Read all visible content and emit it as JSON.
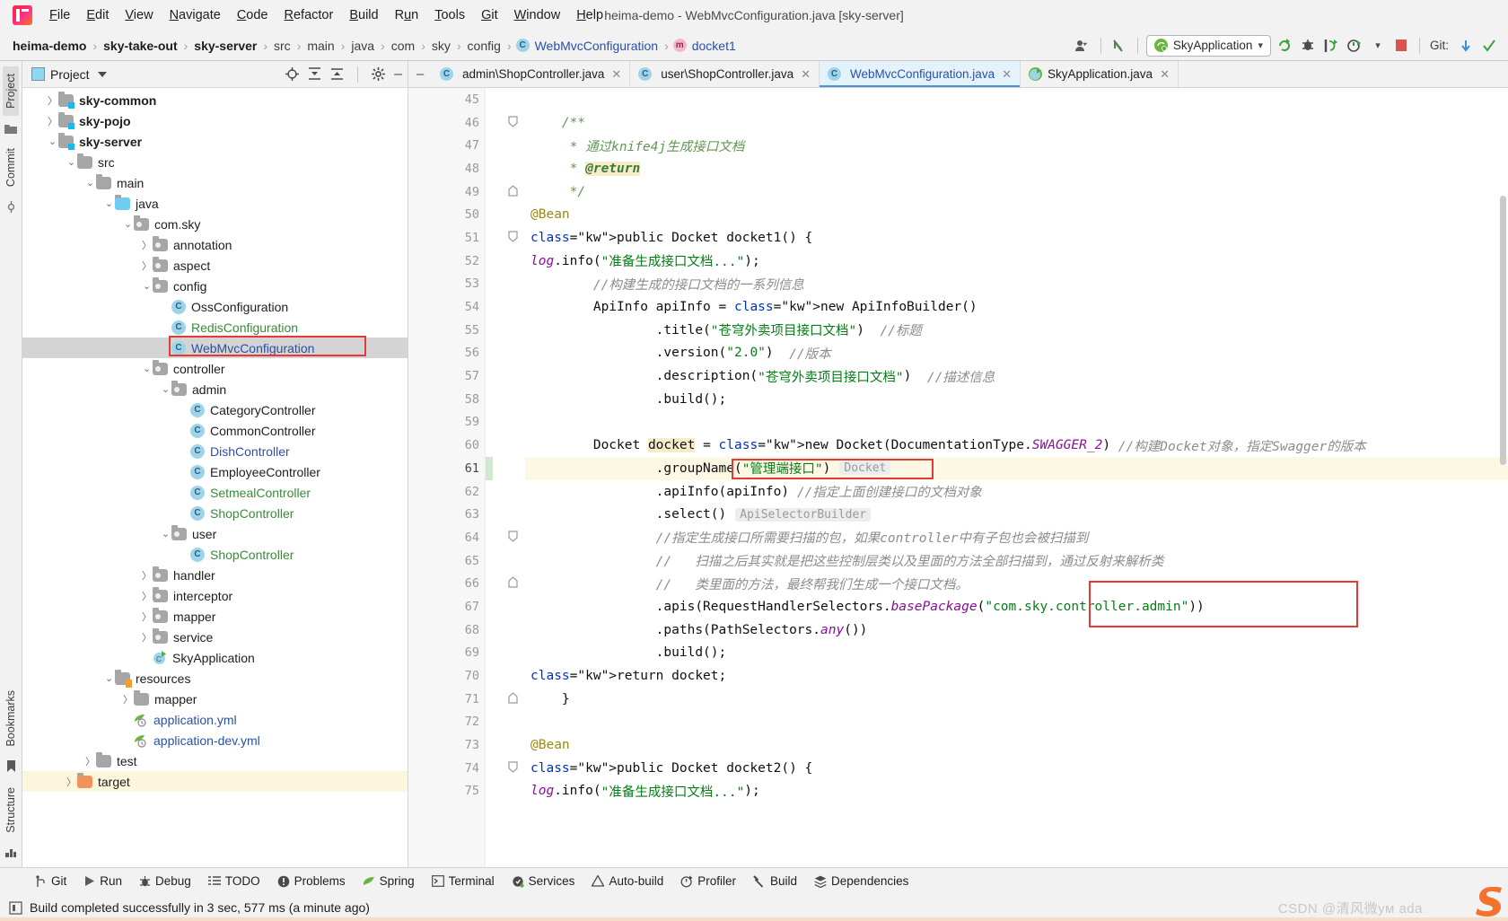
{
  "window": {
    "title": "heima-demo - WebMvcConfiguration.java [sky-server]"
  },
  "menubar": {
    "logo_icon": "intellij-idea-logo",
    "items": [
      {
        "label": "File"
      },
      {
        "label": "Edit"
      },
      {
        "label": "View"
      },
      {
        "label": "Navigate"
      },
      {
        "label": "Code"
      },
      {
        "label": "Refactor"
      },
      {
        "label": "Build"
      },
      {
        "label": "Run"
      },
      {
        "label": "Tools"
      },
      {
        "label": "Git"
      },
      {
        "label": "Window"
      },
      {
        "label": "Help"
      }
    ]
  },
  "navbar": {
    "breadcrumbs": [
      {
        "label": "heima-demo",
        "style": "bold"
      },
      {
        "label": "sky-take-out",
        "style": "bold"
      },
      {
        "label": "sky-server",
        "style": "bold"
      },
      {
        "label": "src",
        "style": "plain"
      },
      {
        "label": "main",
        "style": "plain"
      },
      {
        "label": "java",
        "style": "plain"
      },
      {
        "label": "com",
        "style": "plain"
      },
      {
        "label": "sky",
        "style": "plain"
      },
      {
        "label": "config",
        "style": "plain"
      },
      {
        "label": "WebMvcConfiguration",
        "style": "link",
        "badge": "C"
      },
      {
        "label": "docket1",
        "style": "link",
        "badge": "m"
      }
    ],
    "separator": "›",
    "run_config": {
      "label": "SkyApplication",
      "icon": "spring-boot-icon",
      "dropdown": "▾"
    },
    "icons": [
      {
        "name": "user-settings-icon"
      },
      {
        "name": "undo-arrow-icon"
      },
      {
        "name": "run-icon"
      },
      {
        "name": "debug-icon"
      },
      {
        "name": "run-with-coverage-icon"
      },
      {
        "name": "profiler-icon"
      },
      {
        "name": "stop-icon"
      }
    ],
    "git_label": "Git:",
    "git_icons": [
      {
        "name": "git-update-icon"
      },
      {
        "name": "git-commit-checkmark-icon"
      }
    ]
  },
  "left_strip": {
    "tabs": [
      {
        "label": "Project",
        "selected": true
      },
      {
        "label": "Commit",
        "selected": false
      }
    ],
    "bottom_tabs": [
      {
        "label": "Bookmarks"
      },
      {
        "label": "Structure"
      }
    ]
  },
  "project_panel": {
    "title": "Project",
    "title_icon": "project-view-icon",
    "dropdown_icon": "chevron-down-icon",
    "header_icons": [
      {
        "name": "select-opened-file-icon"
      },
      {
        "name": "expand-all-icon"
      },
      {
        "name": "collapse-all-icon"
      },
      {
        "name": "gear-icon"
      },
      {
        "name": "hide-icon"
      }
    ],
    "tree": [
      {
        "label": "sky-common",
        "indent": 1,
        "arrow": "›",
        "icon": "module-folder-icon",
        "style": "bold"
      },
      {
        "label": "sky-pojo",
        "indent": 1,
        "arrow": "›",
        "icon": "module-folder-icon",
        "style": "bold"
      },
      {
        "label": "sky-server",
        "indent": 1,
        "arrow": "⌄",
        "icon": "module-folder-icon",
        "style": "bold"
      },
      {
        "label": "src",
        "indent": 2,
        "arrow": "⌄",
        "icon": "folder-icon",
        "style": "plain"
      },
      {
        "label": "main",
        "indent": 3,
        "arrow": "⌄",
        "icon": "folder-icon",
        "style": "plain"
      },
      {
        "label": "java",
        "indent": 4,
        "arrow": "⌄",
        "icon": "source-folder-icon",
        "style": "plain"
      },
      {
        "label": "com.sky",
        "indent": 5,
        "arrow": "⌄",
        "icon": "package-icon",
        "style": "plain"
      },
      {
        "label": "annotation",
        "indent": 6,
        "arrow": "›",
        "icon": "package-icon",
        "style": "plain"
      },
      {
        "label": "aspect",
        "indent": 6,
        "arrow": "›",
        "icon": "package-icon",
        "style": "plain"
      },
      {
        "label": "config",
        "indent": 6,
        "arrow": "⌄",
        "icon": "package-icon",
        "style": "plain"
      },
      {
        "label": "OssConfiguration",
        "indent": 7,
        "arrow": "",
        "icon": "java-class-icon",
        "style": "dark"
      },
      {
        "label": "RedisConfiguration",
        "indent": 7,
        "arrow": "",
        "icon": "java-class-icon",
        "style": "green"
      },
      {
        "label": "WebMvcConfiguration",
        "indent": 7,
        "arrow": "",
        "icon": "java-class-icon",
        "style": "blue",
        "selected": true,
        "highlighted": true
      },
      {
        "label": "controller",
        "indent": 6,
        "arrow": "⌄",
        "icon": "package-icon",
        "style": "plain"
      },
      {
        "label": "admin",
        "indent": 7,
        "arrow": "⌄",
        "icon": "package-icon",
        "style": "plain"
      },
      {
        "label": "CategoryController",
        "indent": 8,
        "arrow": "",
        "icon": "java-class-icon",
        "style": "dark"
      },
      {
        "label": "CommonController",
        "indent": 8,
        "arrow": "",
        "icon": "java-class-icon",
        "style": "dark"
      },
      {
        "label": "DishController",
        "indent": 8,
        "arrow": "",
        "icon": "java-class-icon",
        "style": "blue"
      },
      {
        "label": "EmployeeController",
        "indent": 8,
        "arrow": "",
        "icon": "java-class-icon",
        "style": "dark"
      },
      {
        "label": "SetmealController",
        "indent": 8,
        "arrow": "",
        "icon": "java-class-icon",
        "style": "green"
      },
      {
        "label": "ShopController",
        "indent": 8,
        "arrow": "",
        "icon": "java-class-icon",
        "style": "green"
      },
      {
        "label": "user",
        "indent": 7,
        "arrow": "⌄",
        "icon": "package-icon",
        "style": "plain"
      },
      {
        "label": "ShopController",
        "indent": 8,
        "arrow": "",
        "icon": "java-class-icon",
        "style": "green"
      },
      {
        "label": "handler",
        "indent": 6,
        "arrow": "›",
        "icon": "package-icon",
        "style": "plain"
      },
      {
        "label": "interceptor",
        "indent": 6,
        "arrow": "›",
        "icon": "package-icon",
        "style": "plain"
      },
      {
        "label": "mapper",
        "indent": 6,
        "arrow": "›",
        "icon": "package-icon",
        "style": "plain"
      },
      {
        "label": "service",
        "indent": 6,
        "arrow": "›",
        "icon": "package-icon",
        "style": "plain"
      },
      {
        "label": "SkyApplication",
        "indent": 6,
        "arrow": "",
        "icon": "spring-boot-class-icon",
        "style": "dark"
      },
      {
        "label": "resources",
        "indent": 4,
        "arrow": "⌄",
        "icon": "resources-folder-icon",
        "style": "plain"
      },
      {
        "label": "mapper",
        "indent": 5,
        "arrow": "›",
        "icon": "folder-icon",
        "style": "plain"
      },
      {
        "label": "application.yml",
        "indent": 5,
        "arrow": "",
        "icon": "spring-yaml-icon",
        "style": "blue"
      },
      {
        "label": "application-dev.yml",
        "indent": 5,
        "arrow": "",
        "icon": "spring-yaml-icon",
        "style": "blue"
      },
      {
        "label": "test",
        "indent": 3,
        "arrow": "›",
        "icon": "folder-icon",
        "style": "plain"
      },
      {
        "label": "target",
        "indent": 2,
        "arrow": "›",
        "icon": "target-folder-icon",
        "style": "plain",
        "highlighted": true
      }
    ]
  },
  "editor": {
    "collapse_icon": "collapse-editor-icon",
    "tabs": [
      {
        "label": "admin\\ShopController.java",
        "icon": "java-class-icon",
        "close": "✕",
        "active": false
      },
      {
        "label": "user\\ShopController.java",
        "icon": "java-class-icon",
        "close": "✕",
        "active": false
      },
      {
        "label": "WebMvcConfiguration.java",
        "icon": "java-class-icon",
        "close": "✕",
        "active": true
      },
      {
        "label": "SkyApplication.java",
        "icon": "spring-boot-class-icon",
        "close": "✕",
        "active": false
      }
    ],
    "first_line_number": 45,
    "lines": [
      {
        "n": 45,
        "text": ""
      },
      {
        "n": 46,
        "text": "    /**",
        "fold": "⌄"
      },
      {
        "n": 47,
        "text": "     * 通过knife4j生成接口文档"
      },
      {
        "n": 48,
        "text": "     * @return"
      },
      {
        "n": 49,
        "text": "     */",
        "fold": "⌃"
      },
      {
        "n": 50,
        "text": "    @Bean",
        "gutter_icons": "bean-and-run-icon"
      },
      {
        "n": 51,
        "text": "    public Docket docket1() {",
        "fold": "⌄"
      },
      {
        "n": 52,
        "text": "        log.info(\"准备生成接口文档...\");"
      },
      {
        "n": 53,
        "text": "        //构建生成的接口文档的一系列信息"
      },
      {
        "n": 54,
        "text": "        ApiInfo apiInfo = new ApiInfoBuilder()"
      },
      {
        "n": 55,
        "text": "                .title(\"苍穹外卖项目接口文档\")  //标题"
      },
      {
        "n": 56,
        "text": "                .version(\"2.0\")  //版本"
      },
      {
        "n": 57,
        "text": "                .description(\"苍穹外卖项目接口文档\")  //描述信息"
      },
      {
        "n": 58,
        "text": "                .build();"
      },
      {
        "n": 59,
        "text": ""
      },
      {
        "n": 60,
        "text": "        Docket docket = new Docket(DocumentationType.SWAGGER_2) //构建Docket对象，指定Swagger的版本"
      },
      {
        "n": 61,
        "text": "                .groupName(\"管理端接口\")",
        "inlay": "Docket",
        "current": true,
        "redbox": true
      },
      {
        "n": 62,
        "text": "                .apiInfo(apiInfo) //指定上面创建接口的文档对象"
      },
      {
        "n": 63,
        "text": "                .select()",
        "inlay": "ApiSelectorBuilder"
      },
      {
        "n": 64,
        "text": "                //指定生成接口所需要扫描的包，如果controller中有子包也会被扫描到",
        "fold": "⌄"
      },
      {
        "n": 65,
        "text": "                //   扫描之后其实就是把这些控制层类以及里面的方法全部扫描到，通过反射来解析类"
      },
      {
        "n": 66,
        "text": "                //   类里面的方法，最终帮我们生成一个接口文档。",
        "fold": "⌃"
      },
      {
        "n": 67,
        "text": "                .apis(RequestHandlerSelectors.basePackage(\"com.sky.controller.admin\"))",
        "redbox2": true
      },
      {
        "n": 68,
        "text": "                .paths(PathSelectors.any())"
      },
      {
        "n": 69,
        "text": "                .build();"
      },
      {
        "n": 70,
        "text": "        return docket;"
      },
      {
        "n": 71,
        "text": "    }",
        "fold": "⌃"
      },
      {
        "n": 72,
        "text": ""
      },
      {
        "n": 73,
        "text": "    @Bean",
        "gutter_icons": "bean-and-run-icon"
      },
      {
        "n": 74,
        "text": "    public Docket docket2() {",
        "fold": "⌄"
      },
      {
        "n": 75,
        "text": "        log.info(\"准备生成接口文档...\");"
      }
    ],
    "annotations": {
      "red_highlight_groupname": ".groupName(\"管理端接口\")",
      "red_highlight_basepackage": "(\"com.sky.controller.admin\"))"
    }
  },
  "bottom_toolbar": {
    "items": [
      {
        "label": "Git",
        "icon": "git-branch-icon"
      },
      {
        "label": "Run",
        "icon": "run-play-icon"
      },
      {
        "label": "Debug",
        "icon": "debug-bug-icon"
      },
      {
        "label": "TODO",
        "icon": "todo-list-icon"
      },
      {
        "label": "Problems",
        "icon": "problems-warning-icon"
      },
      {
        "label": "Spring",
        "icon": "spring-leaf-icon"
      },
      {
        "label": "Terminal",
        "icon": "terminal-icon"
      },
      {
        "label": "Services",
        "icon": "services-icon"
      },
      {
        "label": "Auto-build",
        "icon": "auto-build-icon"
      },
      {
        "label": "Profiler",
        "icon": "profiler-clock-icon"
      },
      {
        "label": "Build",
        "icon": "build-hammer-icon"
      },
      {
        "label": "Dependencies",
        "icon": "dependencies-layers-icon"
      }
    ]
  },
  "status_bar": {
    "icon": "build-status-icon",
    "message": "Build completed successfully in 3 sec, 577 ms (a minute ago)",
    "watermark": "CSDN @清风微ум ada",
    "ime_icon": "sogou-input-icon"
  },
  "colors": {
    "accent_blue": "#2a50a8",
    "selection_gray": "#d4d4d4",
    "highlight_yellow": "#fdf8e3",
    "red_box": "#e53935",
    "string_green": "#067d17",
    "keyword_blue": "#0033b3",
    "comment_gray": "#8c8c8c"
  }
}
